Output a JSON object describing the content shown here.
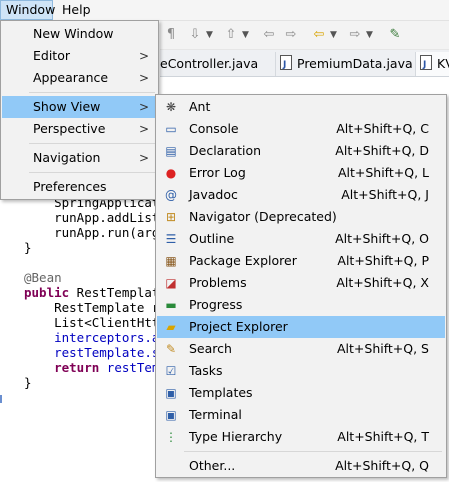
{
  "menubar": {
    "window": "Window",
    "help": "Help"
  },
  "tabs": [
    {
      "label": "eController.java"
    },
    {
      "label": "PremiumData.java"
    },
    {
      "label": "KV"
    }
  ],
  "code_lines": [
    {
      "text": "    SpringApplicati"
    },
    {
      "text": "    runApp.addListe"
    },
    {
      "text": "    runApp.run(args"
    },
    {
      "text": "}"
    },
    {
      "text": ""
    },
    {
      "text": "@Bean"
    },
    {
      "text": "public RestTemplate"
    },
    {
      "text": "    RestTemplate re"
    },
    {
      "text": "    List<ClientHttp"
    },
    {
      "text": "    interceptors.ac"
    },
    {
      "text": "    restTemplate.se"
    },
    {
      "text": "    return restTemp"
    },
    {
      "text": "}"
    }
  ],
  "window_menu": {
    "new_window": "New Window",
    "editor": "Editor",
    "appearance": "Appearance",
    "show_view": "Show View",
    "perspective": "Perspective",
    "navigation": "Navigation",
    "preferences": "Preferences",
    "submenu_arrow": ">"
  },
  "show_view_items": [
    {
      "label": "Ant",
      "accel": "",
      "icon": "ant-icon"
    },
    {
      "label": "Console",
      "accel": "Alt+Shift+Q, C",
      "icon": "console-icon"
    },
    {
      "label": "Declaration",
      "accel": "Alt+Shift+Q, D",
      "icon": "declaration-icon"
    },
    {
      "label": "Error Log",
      "accel": "Alt+Shift+Q, L",
      "icon": "error-log-icon"
    },
    {
      "label": "Javadoc",
      "accel": "Alt+Shift+Q, J",
      "icon": "javadoc-icon"
    },
    {
      "label": "Navigator (Deprecated)",
      "accel": "",
      "icon": "navigator-icon"
    },
    {
      "label": "Outline",
      "accel": "Alt+Shift+Q, O",
      "icon": "outline-icon"
    },
    {
      "label": "Package Explorer",
      "accel": "Alt+Shift+Q, P",
      "icon": "package-explorer-icon"
    },
    {
      "label": "Problems",
      "accel": "Alt+Shift+Q, X",
      "icon": "problems-icon"
    },
    {
      "label": "Progress",
      "accel": "",
      "icon": "progress-icon"
    },
    {
      "label": "Project Explorer",
      "accel": "",
      "icon": "project-explorer-icon"
    },
    {
      "label": "Search",
      "accel": "Alt+Shift+Q, S",
      "icon": "search-icon"
    },
    {
      "label": "Tasks",
      "accel": "",
      "icon": "tasks-icon"
    },
    {
      "label": "Templates",
      "accel": "",
      "icon": "templates-icon"
    },
    {
      "label": "Terminal",
      "accel": "",
      "icon": "terminal-icon"
    },
    {
      "label": "Type Hierarchy",
      "accel": "Alt+Shift+Q, T",
      "icon": "type-hierarchy-icon"
    }
  ],
  "show_view_other": {
    "label": "Other...",
    "accel": "Alt+Shift+Q, Q"
  },
  "colors": {
    "highlight": "#91c9f7",
    "menu_bg": "#f2f2f2",
    "keyword": "#7f0055",
    "annotation": "#646464",
    "field": "#0000c0"
  }
}
